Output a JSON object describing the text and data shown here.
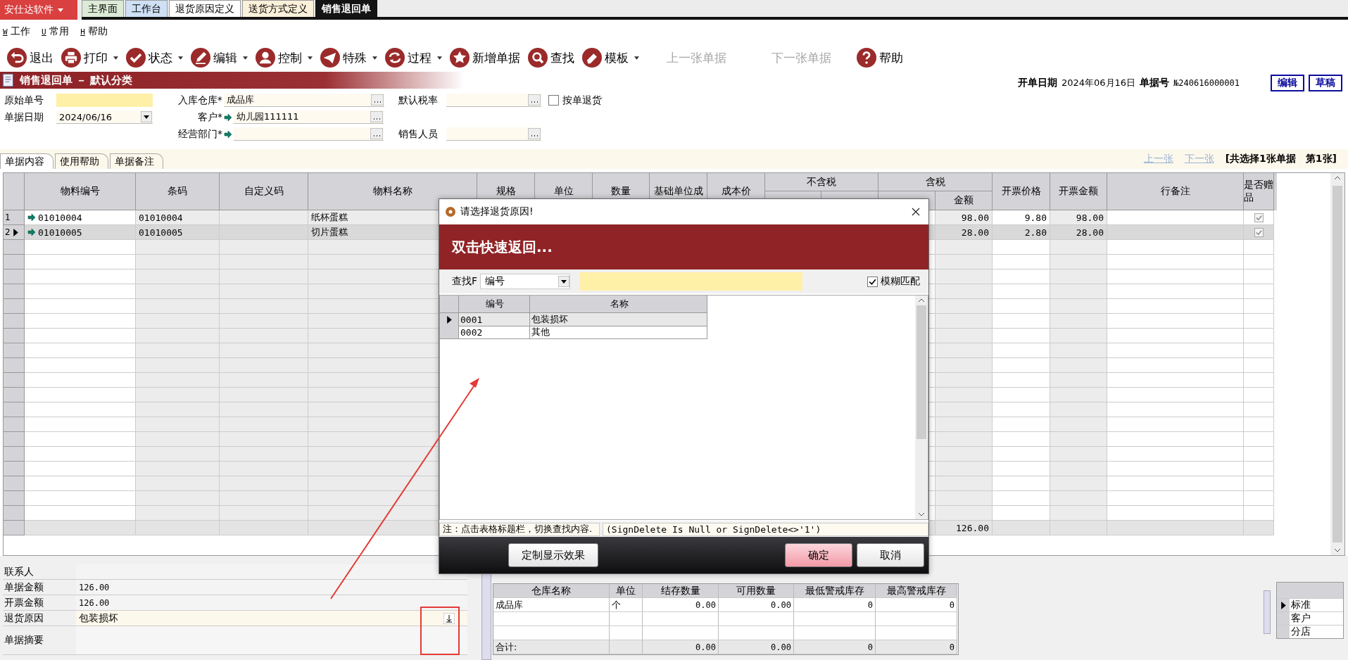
{
  "top_tabs": {
    "app_button": "安仕达软件",
    "tabs": [
      {
        "label": "主界面",
        "color": "#dcebd6",
        "selected": false
      },
      {
        "label": "工作台",
        "color": "#cfe0f5",
        "selected": false
      },
      {
        "label": "退货原因定义",
        "color": "#ffffff",
        "selected": false
      },
      {
        "label": "送货方式定义",
        "color": "#fbf0d9",
        "selected": false
      },
      {
        "label": "销售退回单",
        "color": "#141414",
        "selected": true
      }
    ]
  },
  "menu": [
    {
      "key": "W",
      "label": "工作"
    },
    {
      "key": "U",
      "label": "常用"
    },
    {
      "key": "H",
      "label": "帮助"
    }
  ],
  "toolbar": [
    {
      "label": "退出",
      "kind": "exit",
      "dropdown": false,
      "disabled": false
    },
    {
      "label": "打印",
      "kind": "print",
      "dropdown": true,
      "disabled": false
    },
    {
      "label": "状态",
      "kind": "status",
      "dropdown": true,
      "disabled": false
    },
    {
      "label": "编辑",
      "kind": "edit",
      "dropdown": true,
      "disabled": false
    },
    {
      "label": "控制",
      "kind": "control",
      "dropdown": true,
      "disabled": false
    },
    {
      "label": "特殊",
      "kind": "special",
      "dropdown": true,
      "disabled": false
    },
    {
      "label": "过程",
      "kind": "process",
      "dropdown": true,
      "disabled": false
    },
    {
      "label": "新增单据",
      "kind": "new",
      "dropdown": false,
      "disabled": false
    },
    {
      "label": "查找",
      "kind": "find",
      "dropdown": false,
      "disabled": false
    },
    {
      "label": "模板",
      "kind": "template",
      "dropdown": true,
      "disabled": false
    },
    {
      "label": "上一张单据",
      "kind": "none",
      "dropdown": false,
      "disabled": true
    },
    {
      "label": "下一张单据",
      "kind": "none",
      "dropdown": false,
      "disabled": true
    },
    {
      "label": "帮助",
      "kind": "help",
      "dropdown": false,
      "disabled": false
    }
  ],
  "form": {
    "title": "销售退回单 － 默认分类",
    "date_label": "开单日期",
    "date": "2024年06月16日",
    "number_label": "单据号",
    "number": "№240616000001",
    "buttons": [
      "编辑",
      "草稿"
    ],
    "fields": {
      "original_no": {
        "label": "原始单号"
      },
      "doc_date": {
        "label": "单据日期",
        "value": "2024/06/16"
      },
      "warehouse": {
        "label": "入库仓库*",
        "value": "成品库"
      },
      "customer": {
        "label": "客户*",
        "value": "幼儿园111111"
      },
      "department": {
        "label": "经营部门*"
      },
      "tax_rate": {
        "label": "默认税率"
      },
      "return_by_doc": {
        "label": "按单退货",
        "checked": false
      },
      "salesperson": {
        "label": "销售人员"
      }
    }
  },
  "sub_tabs": [
    {
      "label": "单据内容",
      "selected": true
    },
    {
      "label": "使用帮助",
      "selected": false
    },
    {
      "label": "单据备注",
      "selected": false
    }
  ],
  "pager": {
    "prev": "上一张",
    "next": "下一张",
    "summary": "[共选择1张单据　第1张]"
  },
  "grid": {
    "columns": [
      {
        "label": "物料编号",
        "kind": "single"
      },
      {
        "label": "条码",
        "kind": "single"
      },
      {
        "label": "自定义码",
        "kind": "single"
      },
      {
        "label": "物料名称",
        "kind": "single"
      },
      {
        "label": "规格",
        "kind": "single"
      },
      {
        "label": "单位",
        "kind": "single"
      },
      {
        "label": "数量",
        "kind": "single"
      },
      {
        "label": "基础单位成",
        "kind": "single"
      },
      {
        "label": "成本价",
        "kind": "single"
      },
      {
        "label": "不含税",
        "kind": "group"
      },
      {
        "label": "含税",
        "kind": "group",
        "amount_label": "金额"
      },
      {
        "label": "开票价格",
        "kind": "single"
      },
      {
        "label": "开票金额",
        "kind": "single"
      },
      {
        "label": "行备注",
        "kind": "single"
      },
      {
        "label": "是否赠品",
        "kind": "single"
      }
    ],
    "rows": [
      {
        "no": "1",
        "selected": false,
        "item_code": "01010004",
        "barcode": "01010004",
        "name": "纸杯蛋糕",
        "incl_tax_amount": "98.00",
        "invoice_price": "9.80",
        "invoice_amount": "98.00",
        "gift": true
      },
      {
        "no": "2",
        "selected": true,
        "item_code": "01010005",
        "barcode": "01010005",
        "name": "切片蛋糕",
        "incl_tax_amount": "28.00",
        "invoice_price": "2.80",
        "invoice_amount": "28.00",
        "gift": true
      }
    ],
    "total": "126.00"
  },
  "summary_panel": [
    {
      "label": "联系人",
      "kind": "text"
    },
    {
      "label": "单据金额",
      "value": "126.00",
      "kind": "text"
    },
    {
      "label": "开票金额",
      "value": "126.00",
      "kind": "text"
    },
    {
      "label": "退货原因",
      "value": "包装损坏",
      "kind": "dropdown"
    },
    {
      "label": "单据摘要",
      "kind": "memo"
    }
  ],
  "stock": {
    "columns": [
      "仓库名称",
      "单位",
      "结存数量",
      "可用数量",
      "最低警戒库存",
      "最高警戒库存"
    ],
    "rows": [
      {
        "cells": [
          "成品库",
          "个",
          "0.00",
          "0.00",
          "0",
          "0"
        ]
      }
    ],
    "total": {
      "label": "合计:",
      "cells": [
        "0.00",
        "0.00",
        "0",
        "0"
      ]
    }
  },
  "side_list": [
    {
      "label": "标准",
      "selected": true
    },
    {
      "label": "客户",
      "selected": false
    },
    {
      "label": "分店",
      "selected": false
    }
  ],
  "dialog": {
    "title": "请选择退货原因!",
    "banner": "双击快速返回...",
    "search": {
      "label": "查找F",
      "field": "编号",
      "fuzzy": {
        "label": "模糊匹配",
        "checked": true
      }
    },
    "columns": [
      "编号",
      "名称"
    ],
    "rows": [
      {
        "code": "0001",
        "name": "包装损坏",
        "selected": true
      },
      {
        "code": "0002",
        "name": "其他",
        "selected": false
      }
    ],
    "note": "注：点击表格标题栏，切换查找内容.",
    "filter": "(SignDelete Is Null or SignDelete<>'1')",
    "buttons": [
      {
        "label": "定制显示效果",
        "kind": "custom"
      },
      {
        "label": "确定",
        "kind": "primary"
      },
      {
        "label": "取消",
        "kind": "cancel"
      }
    ]
  },
  "annotations": {
    "arrow": true,
    "frame": true
  }
}
